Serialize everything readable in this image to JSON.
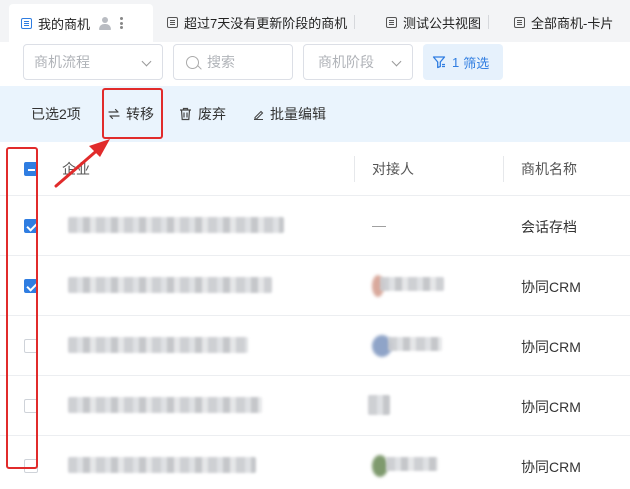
{
  "tabs": [
    {
      "label": "我的商机",
      "active": true
    },
    {
      "label": "超过7天没有更新阶段的商机",
      "active": false
    },
    {
      "label": "测试公共视图",
      "active": false
    },
    {
      "label": "全部商机-卡片",
      "active": false
    }
  ],
  "filters": {
    "pipeline_placeholder": "商机流程",
    "search_placeholder": "搜索",
    "stage_placeholder": "商机阶段",
    "filter_count": "1",
    "filter_label": "筛选"
  },
  "actions": {
    "selected_text": "已选2项",
    "transfer": "转移",
    "discard": "废弃",
    "bulk_edit": "批量编辑"
  },
  "table": {
    "headers": [
      "企业",
      "对接人",
      "商机名称"
    ],
    "rows": [
      {
        "checked": true,
        "company": "",
        "contact": "—",
        "opportunity": "会话存档"
      },
      {
        "checked": true,
        "company": "",
        "contact": "",
        "opportunity": "协同CRM"
      },
      {
        "checked": false,
        "company": "",
        "contact": "",
        "opportunity": "协同CRM"
      },
      {
        "checked": false,
        "company": "",
        "contact": "",
        "opportunity": "协同CRM"
      },
      {
        "checked": false,
        "company": "",
        "contact": "",
        "opportunity": "协同CRM"
      }
    ]
  },
  "colors": {
    "accent": "#2f7de1",
    "annotation": "#e12b2b",
    "action_bar_bg": "#eaf4fd"
  }
}
